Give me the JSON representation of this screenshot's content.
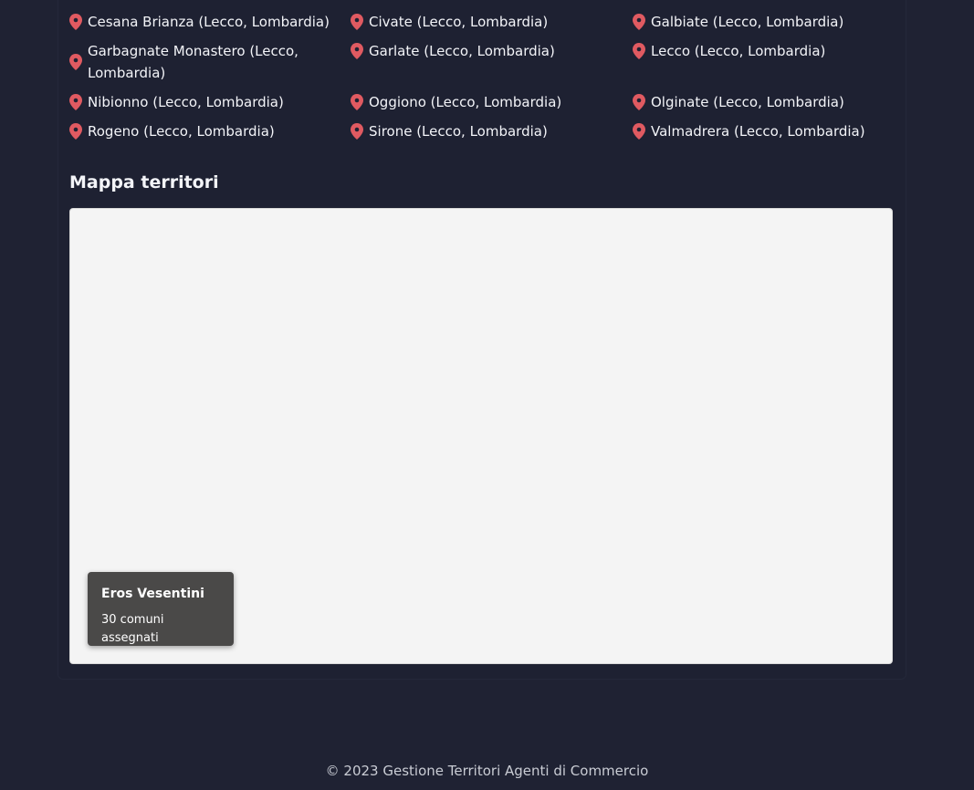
{
  "municipalities": [
    {
      "label": "Cesana Brianza (Lecco, Lombardia)"
    },
    {
      "label": "Civate (Lecco, Lombardia)"
    },
    {
      "label": "Galbiate (Lecco, Lombardia)"
    },
    {
      "label": "Garbagnate Monastero (Lecco, Lombardia)"
    },
    {
      "label": "Garlate (Lecco, Lombardia)"
    },
    {
      "label": "Lecco (Lecco, Lombardia)"
    },
    {
      "label": "Nibionno (Lecco, Lombardia)"
    },
    {
      "label": "Oggiono (Lecco, Lombardia)"
    },
    {
      "label": "Olginate (Lecco, Lombardia)"
    },
    {
      "label": "Rogeno (Lecco, Lombardia)"
    },
    {
      "label": "Sirone (Lecco, Lombardia)"
    },
    {
      "label": "Valmadrera (Lecco, Lombardia)"
    }
  ],
  "map_section": {
    "title": "Mappa territori",
    "legend": {
      "agent_name": "Eros Vesentini",
      "assigned_count": "30 comuni assegnati"
    }
  },
  "footer": {
    "text": "© 2023 Gestione Territori Agenti di Commercio"
  },
  "icons": {
    "pin": "map-marker-icon"
  },
  "colors": {
    "background": "#1f2233",
    "pin": "#e05a61",
    "map_background": "#f4f4f4",
    "legend_background": "#4a4948"
  }
}
